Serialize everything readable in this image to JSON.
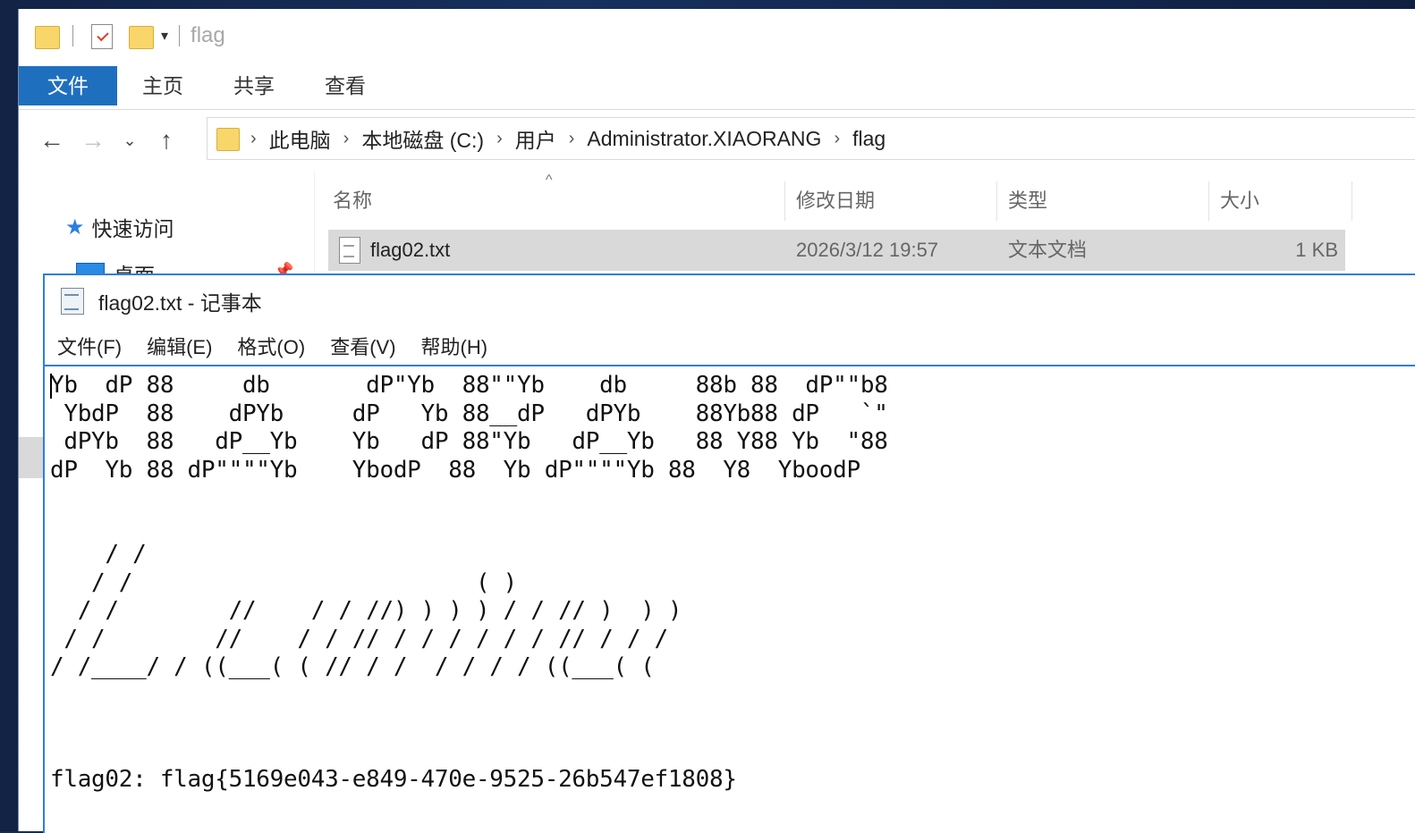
{
  "explorer": {
    "title": "flag",
    "ribbon_tabs": [
      "文件",
      "主页",
      "共享",
      "查看"
    ],
    "breadcrumb": [
      "此电脑",
      "本地磁盘 (C:)",
      "用户",
      "Administrator.XIAORANG",
      "flag"
    ],
    "nav": {
      "quick_access": "快速访问",
      "desktop": "桌面"
    },
    "columns": {
      "name": "名称",
      "date": "修改日期",
      "type": "类型",
      "size": "大小"
    },
    "files": [
      {
        "name": "flag02.txt",
        "date": "2026/3/12 19:57",
        "type": "文本文档",
        "size": "1 KB"
      }
    ]
  },
  "notepad": {
    "title": "flag02.txt - 记事本",
    "menu": [
      "文件(F)",
      "编辑(E)",
      "格式(O)",
      "查看(V)",
      "帮助(H)"
    ],
    "content": "Yb  dP 88     db       dP\"Yb  88\"\"Yb    db     88b 88  dP\"\"b8\n YbdP  88    dPYb     dP   Yb 88__dP   dPYb    88Yb88 dP   `\"\n dPYb  88   dP__Yb    Yb   dP 88\"Yb   dP__Yb   88 Y88 Yb  \"88\ndP  Yb 88 dP\"\"\"\"Yb    YbodP  88  Yb dP\"\"\"\"Yb 88  Y8  YboodP\n\n\n    / /\n   / /                         ( )\n  / /        //    / / //) ) ) ) / / // )  ) )\n / /        //    / / // / / / / / / // / / /\n/ /____/ / ((___( ( // / /  / / / / ((___( (\n\n\n\nflag02: flag{5169e043-e849-470e-9525-26b547ef1808}"
  }
}
